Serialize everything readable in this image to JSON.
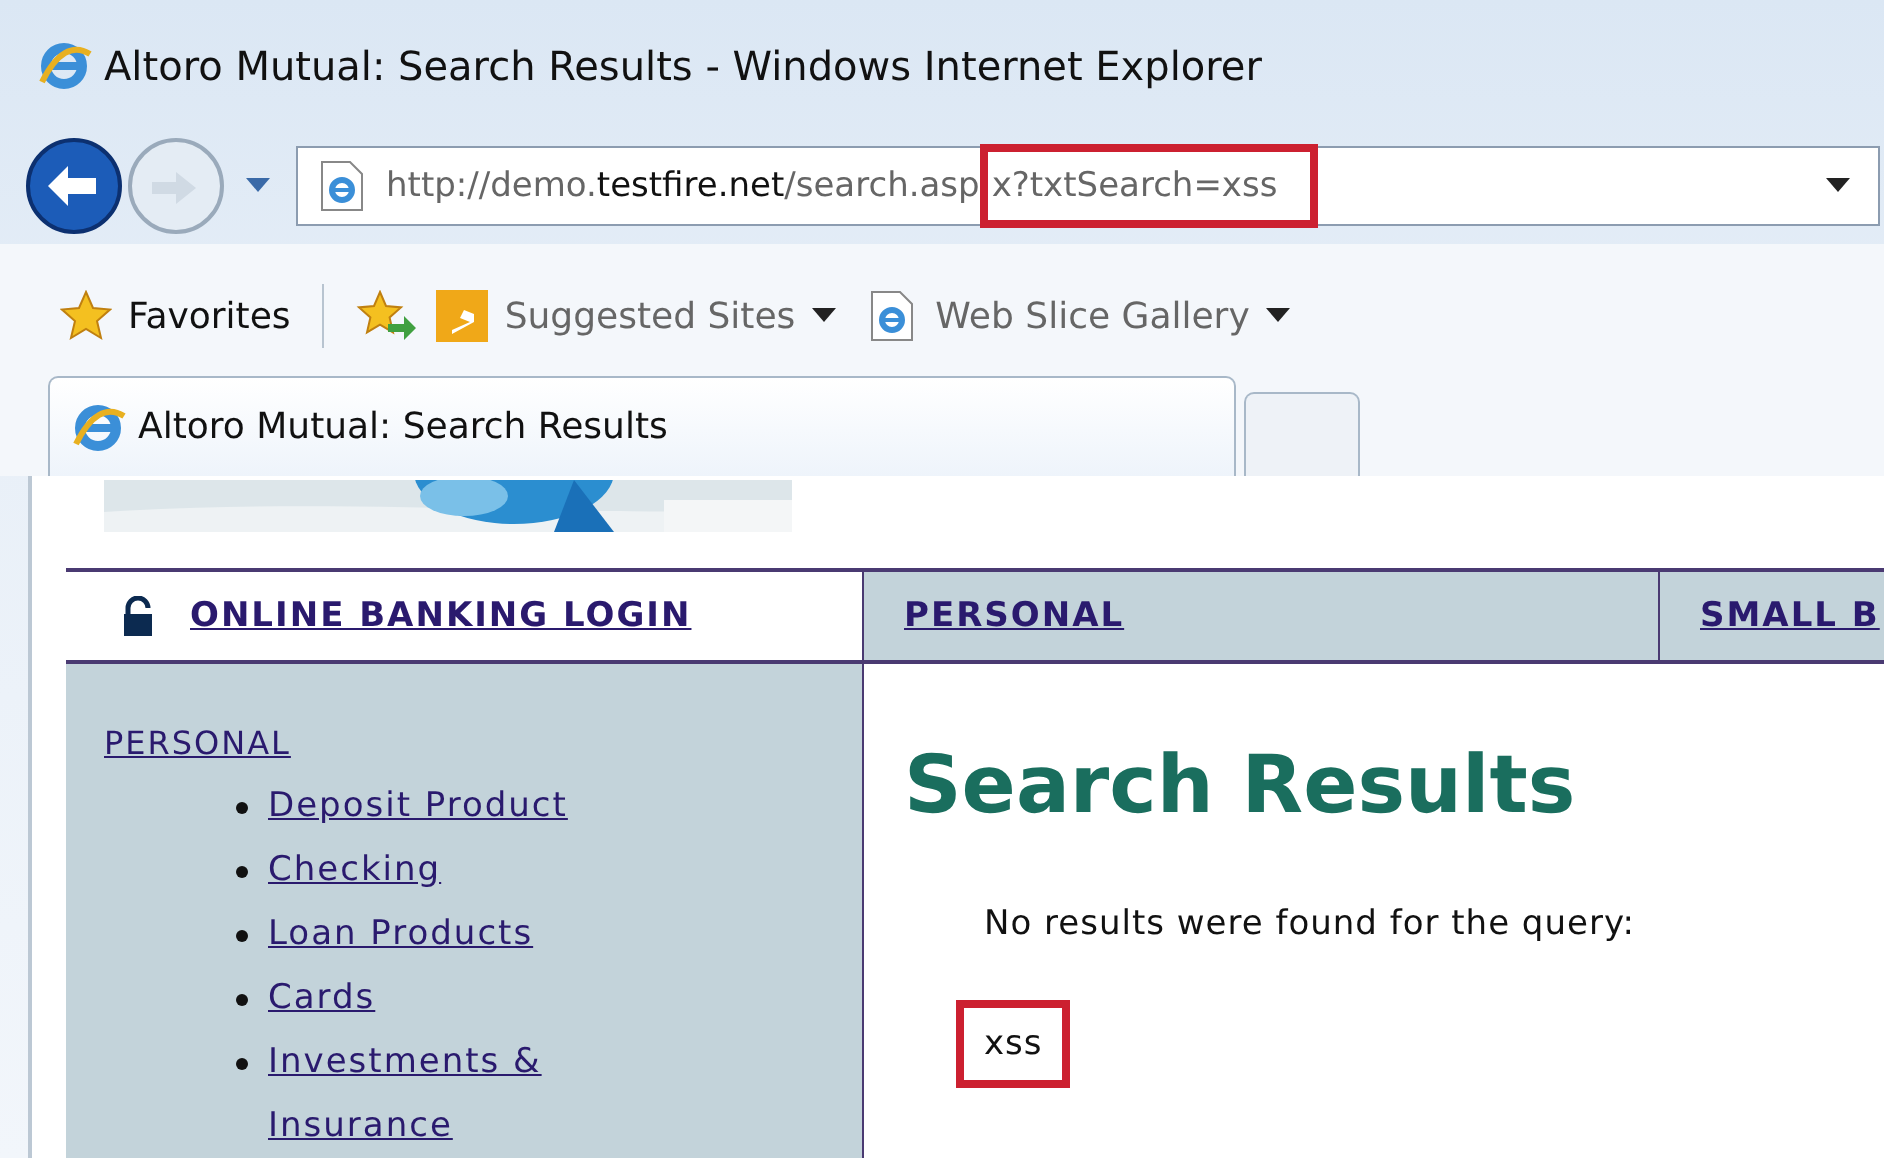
{
  "window": {
    "title": "Altoro Mutual: Search Results - Windows Internet Explorer"
  },
  "address_bar": {
    "url_parts": [
      {
        "text": "http://demo.",
        "emphasis": false,
        "highlighted": false
      },
      {
        "text": "testfire.net",
        "emphasis": true,
        "highlighted": false
      },
      {
        "text": "/search.asp",
        "emphasis": false,
        "highlighted": false
      },
      {
        "text": "x?txtSearch=xss",
        "emphasis": false,
        "highlighted": true
      }
    ]
  },
  "favorites_bar": {
    "favorites": "Favorites",
    "links": [
      {
        "label": "Suggested Sites",
        "kind": "bing"
      },
      {
        "label": "Web Slice Gallery",
        "kind": "page"
      }
    ]
  },
  "tabs": [
    {
      "label": "Altoro Mutual: Search Results",
      "selected": true
    }
  ],
  "page": {
    "nav": [
      {
        "label": "ONLINE BANKING LOGIN",
        "kind": "login"
      },
      {
        "label": "PERSONAL",
        "kind": "section"
      },
      {
        "label": "SMALL B",
        "kind": "section"
      }
    ],
    "sidebar": {
      "heading": "PERSONAL",
      "items": [
        "Deposit Product",
        "Checking",
        "Loan Products",
        "Cards",
        "Investments & Insurance"
      ]
    },
    "heading": "Search Results",
    "message": "No results were found for the query:",
    "query": {
      "text": "xss",
      "highlighted": true
    }
  }
}
